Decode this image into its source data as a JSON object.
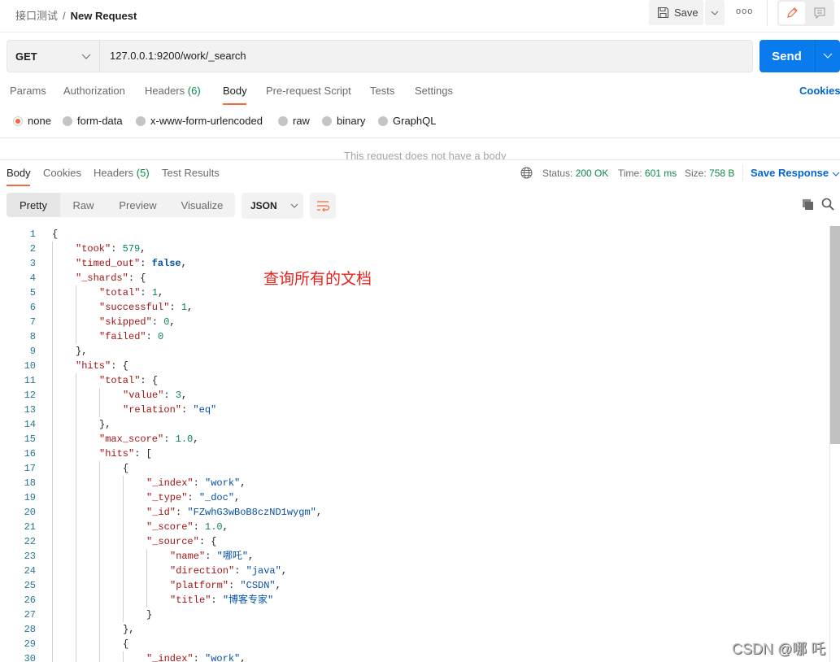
{
  "header": {
    "collection": "接口测试",
    "separator": "/",
    "request_name": "New Request",
    "save_label": "Save"
  },
  "request": {
    "method": "GET",
    "url": "127.0.0.1:9200/work/_search",
    "send_label": "Send"
  },
  "request_tabs": [
    {
      "label": "Params"
    },
    {
      "label": "Authorization"
    },
    {
      "label": "Headers",
      "count": "(6)"
    },
    {
      "label": "Body",
      "active": true
    },
    {
      "label": "Pre-request Script"
    },
    {
      "label": "Tests"
    },
    {
      "label": "Settings"
    }
  ],
  "cookies_label": "Cookies",
  "body_types": [
    {
      "label": "none",
      "selected": true
    },
    {
      "label": "form-data"
    },
    {
      "label": "x-www-form-urlencoded"
    },
    {
      "label": "raw"
    },
    {
      "label": "binary"
    },
    {
      "label": "GraphQL"
    }
  ],
  "no_body_text": "This request does not have a body",
  "response_tabs": [
    {
      "label": "Body",
      "active": true
    },
    {
      "label": "Cookies"
    },
    {
      "label": "Headers",
      "count": "(5)"
    },
    {
      "label": "Test Results"
    }
  ],
  "status": {
    "status_label": "Status:",
    "status_value": "200 OK",
    "time_label": "Time:",
    "time_value": "601 ms",
    "size_label": "Size:",
    "size_value": "758 B",
    "save_response": "Save Response"
  },
  "view_modes": [
    {
      "label": "Pretty",
      "active": true
    },
    {
      "label": "Raw"
    },
    {
      "label": "Preview"
    },
    {
      "label": "Visualize"
    }
  ],
  "format": "JSON",
  "annotation": "查询所有的文档",
  "watermark": "CSDN @哪 吒",
  "colors": {
    "accent": "#f26b3a",
    "send": "#097bed",
    "link": "#0265d2",
    "status_ok": "#0d8a4a",
    "json_key": "#a31515",
    "json_string": "#0451a5",
    "json_number": "#098658",
    "annotation": "#e8221a"
  },
  "code_lines": [
    [
      0,
      [
        [
          "p",
          "{"
        ]
      ]
    ],
    [
      1,
      [
        [
          "k",
          "\"took\""
        ],
        [
          "p",
          ": "
        ],
        [
          "n",
          "579"
        ],
        [
          "p",
          ","
        ]
      ]
    ],
    [
      1,
      [
        [
          "k",
          "\"timed_out\""
        ],
        [
          "p",
          ": "
        ],
        [
          "b",
          "false"
        ],
        [
          "p",
          ","
        ]
      ]
    ],
    [
      1,
      [
        [
          "k",
          "\"_shards\""
        ],
        [
          "p",
          ": {"
        ]
      ]
    ],
    [
      2,
      [
        [
          "k",
          "\"total\""
        ],
        [
          "p",
          ": "
        ],
        [
          "n",
          "1"
        ],
        [
          "p",
          ","
        ]
      ]
    ],
    [
      2,
      [
        [
          "k",
          "\"successful\""
        ],
        [
          "p",
          ": "
        ],
        [
          "n",
          "1"
        ],
        [
          "p",
          ","
        ]
      ]
    ],
    [
      2,
      [
        [
          "k",
          "\"skipped\""
        ],
        [
          "p",
          ": "
        ],
        [
          "n",
          "0"
        ],
        [
          "p",
          ","
        ]
      ]
    ],
    [
      2,
      [
        [
          "k",
          "\"failed\""
        ],
        [
          "p",
          ": "
        ],
        [
          "n",
          "0"
        ]
      ]
    ],
    [
      1,
      [
        [
          "p",
          "},"
        ]
      ]
    ],
    [
      1,
      [
        [
          "k",
          "\"hits\""
        ],
        [
          "p",
          ": {"
        ]
      ]
    ],
    [
      2,
      [
        [
          "k",
          "\"total\""
        ],
        [
          "p",
          ": {"
        ]
      ]
    ],
    [
      3,
      [
        [
          "k",
          "\"value\""
        ],
        [
          "p",
          ": "
        ],
        [
          "n",
          "3"
        ],
        [
          "p",
          ","
        ]
      ]
    ],
    [
      3,
      [
        [
          "k",
          "\"relation\""
        ],
        [
          "p",
          ": "
        ],
        [
          "s",
          "\"eq\""
        ]
      ]
    ],
    [
      2,
      [
        [
          "p",
          "},"
        ]
      ]
    ],
    [
      2,
      [
        [
          "k",
          "\"max_score\""
        ],
        [
          "p",
          ": "
        ],
        [
          "n",
          "1.0"
        ],
        [
          "p",
          ","
        ]
      ]
    ],
    [
      2,
      [
        [
          "k",
          "\"hits\""
        ],
        [
          "p",
          ": ["
        ]
      ]
    ],
    [
      3,
      [
        [
          "p",
          "{"
        ]
      ]
    ],
    [
      4,
      [
        [
          "k",
          "\"_index\""
        ],
        [
          "p",
          ": "
        ],
        [
          "s",
          "\"work\""
        ],
        [
          "p",
          ","
        ]
      ]
    ],
    [
      4,
      [
        [
          "k",
          "\"_type\""
        ],
        [
          "p",
          ": "
        ],
        [
          "s",
          "\"_doc\""
        ],
        [
          "p",
          ","
        ]
      ]
    ],
    [
      4,
      [
        [
          "k",
          "\"_id\""
        ],
        [
          "p",
          ": "
        ],
        [
          "s",
          "\"FZwhG3wBoB8czND1wygm\""
        ],
        [
          "p",
          ","
        ]
      ]
    ],
    [
      4,
      [
        [
          "k",
          "\"_score\""
        ],
        [
          "p",
          ": "
        ],
        [
          "n",
          "1.0"
        ],
        [
          "p",
          ","
        ]
      ]
    ],
    [
      4,
      [
        [
          "k",
          "\"_source\""
        ],
        [
          "p",
          ": {"
        ]
      ]
    ],
    [
      5,
      [
        [
          "k",
          "\"name\""
        ],
        [
          "p",
          ": "
        ],
        [
          "s",
          "\"哪吒\""
        ],
        [
          "p",
          ","
        ]
      ]
    ],
    [
      5,
      [
        [
          "k",
          "\"direction\""
        ],
        [
          "p",
          ": "
        ],
        [
          "s",
          "\"java\""
        ],
        [
          "p",
          ","
        ]
      ]
    ],
    [
      5,
      [
        [
          "k",
          "\"platform\""
        ],
        [
          "p",
          ": "
        ],
        [
          "s",
          "\"CSDN\""
        ],
        [
          "p",
          ","
        ]
      ]
    ],
    [
      5,
      [
        [
          "k",
          "\"title\""
        ],
        [
          "p",
          ": "
        ],
        [
          "s",
          "\"博客专家\""
        ]
      ]
    ],
    [
      4,
      [
        [
          "p",
          "}"
        ]
      ]
    ],
    [
      3,
      [
        [
          "p",
          "},"
        ]
      ]
    ],
    [
      3,
      [
        [
          "p",
          "{"
        ]
      ]
    ],
    [
      4,
      [
        [
          "k",
          "\"_index\""
        ],
        [
          "p",
          ": "
        ],
        [
          "s",
          "\"work\""
        ],
        [
          "p",
          ","
        ]
      ]
    ]
  ]
}
